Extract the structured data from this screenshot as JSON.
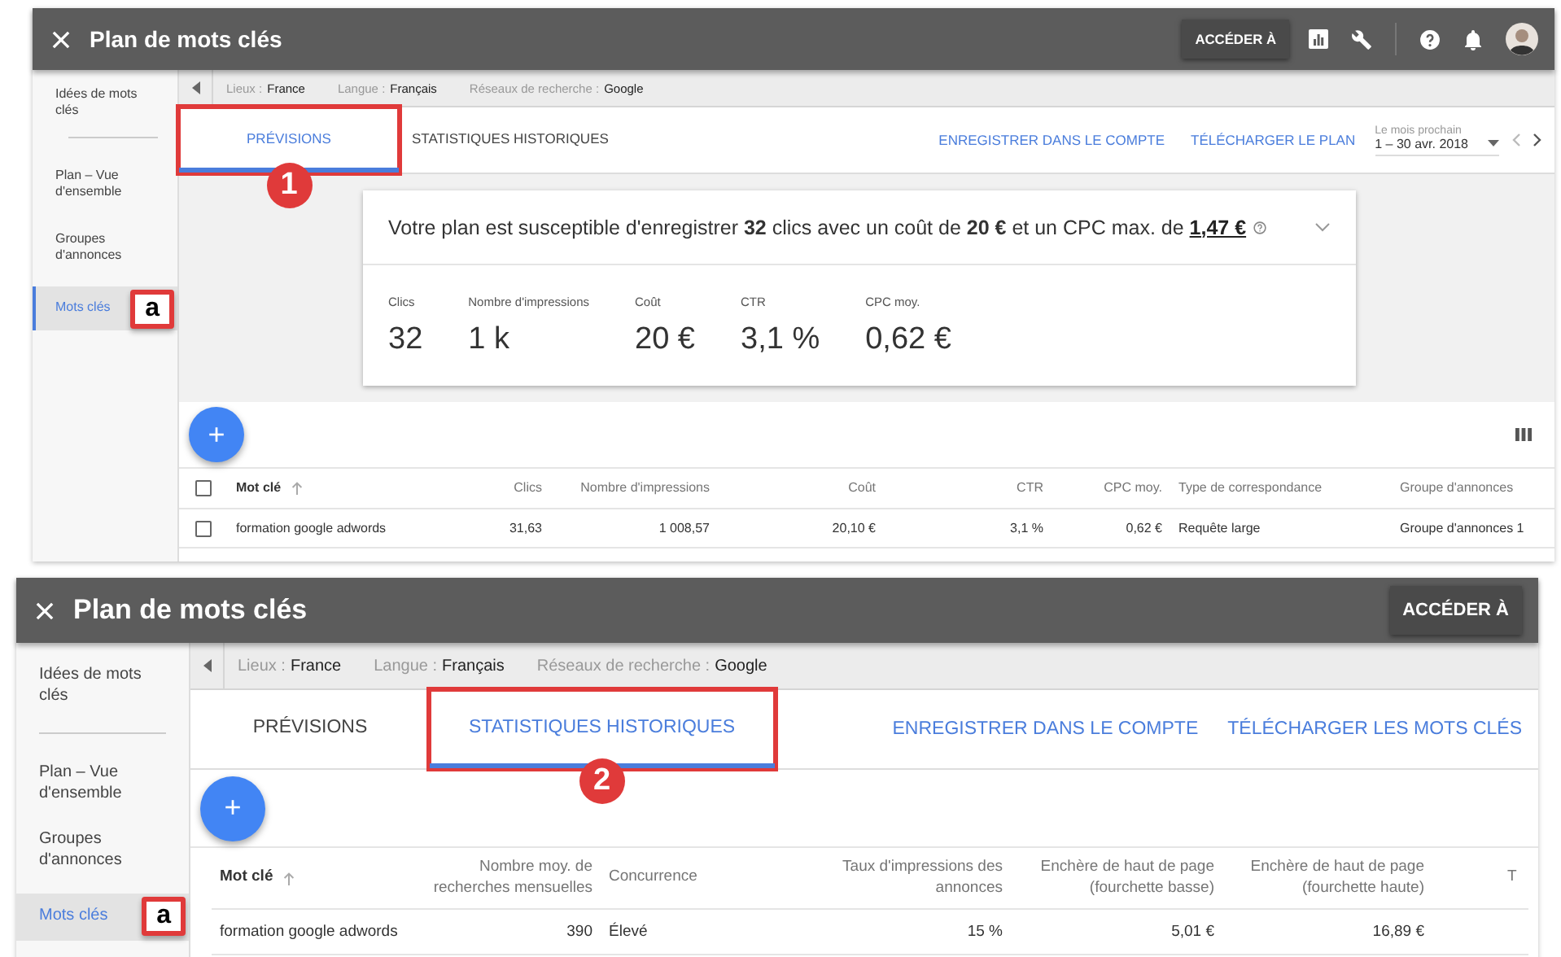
{
  "panels": [
    {
      "title": "Plan de mots clés",
      "goto_button": "ACCÉDER À",
      "header_tools": [
        {
          "kind": "chart"
        },
        {
          "kind": "wrench"
        },
        {
          "kind": "separator"
        },
        {
          "kind": "help"
        },
        {
          "kind": "bell"
        },
        {
          "kind": "avatar"
        }
      ],
      "sidebar": [
        {
          "label": "Idées de mots clés",
          "selected": false,
          "divider_after": true
        },
        {
          "label": "Plan – Vue d'ensemble",
          "selected": false,
          "divider_after": false
        },
        {
          "label": "Groupes d'annonces",
          "selected": false,
          "divider_after": false
        },
        {
          "label": "Mots clés",
          "selected": true,
          "divider_after": false,
          "badge": "a"
        }
      ],
      "filters": [
        {
          "label": "Lieux :",
          "value": "France"
        },
        {
          "label": "Langue :",
          "value": "Français"
        },
        {
          "label": "Réseaux de recherche :",
          "value": "Google"
        }
      ],
      "tabs": [
        {
          "label": "PRÉVISIONS",
          "selected": true,
          "callout": "1"
        },
        {
          "label": "STATISTIQUES HISTORIQUES",
          "selected": false
        }
      ],
      "actions": [
        "ENREGISTRER DANS LE COMPTE",
        "TÉLÉCHARGER LE PLAN"
      ],
      "date_range": {
        "label": "Le mois prochain",
        "value": "1 – 30 avr. 2018"
      },
      "summary": {
        "sentence": "Votre plan est susceptible d'enregistrer **32** clics avec un coût de **20 €** et un CPC max. de",
        "link": "1,47 €",
        "metrics": [
          {
            "label": "Clics",
            "value": "32"
          },
          {
            "label": "Nombre d'impressions",
            "value": "1 k"
          },
          {
            "label": "Coût",
            "value": "20 €"
          },
          {
            "label": "CTR",
            "value": "3,1 %"
          },
          {
            "label": "CPC moy.",
            "value": "0,62 €"
          }
        ]
      },
      "fab": "+",
      "column_picker": true,
      "table": {
        "header_checked": false,
        "columns": [
          {
            "label": "Mot clé",
            "kind": "text",
            "sorted": true
          },
          {
            "label": "Clics",
            "kind": "number",
            "sorted": false
          },
          {
            "label": "Nombre d'impressions",
            "kind": "number",
            "sorted": false
          },
          {
            "label": "Coût",
            "kind": "number",
            "sorted": false
          },
          {
            "label": "CTR",
            "kind": "number",
            "sorted": false
          },
          {
            "label": "CPC moy.",
            "kind": "number",
            "sorted": false
          },
          {
            "label": "Type de correspondance",
            "kind": "text",
            "sorted": false
          },
          {
            "label": "Groupe d'annonces",
            "kind": "text",
            "sorted": false
          }
        ],
        "rows": [
          {
            "checked": false,
            "cells": [
              "formation google adwords",
              "31,63",
              "1 008,57",
              "20,10 €",
              "3,1 %",
              "0,62 €",
              "Requête large",
              "Groupe d'annonces 1"
            ]
          }
        ]
      }
    },
    {
      "title": "Plan de mots clés",
      "goto_button": "ACCÉDER À",
      "sidebar": [
        {
          "label": "Idées de mots clés",
          "selected": false,
          "divider_after": true
        },
        {
          "label": "Plan – Vue d'ensemble",
          "selected": false,
          "divider_after": false
        },
        {
          "label": "Groupes d'annonces",
          "selected": false,
          "divider_after": false
        },
        {
          "label": "Mots clés",
          "selected": true,
          "divider_after": false,
          "badge": "a"
        }
      ],
      "filters": [
        {
          "label": "Lieux :",
          "value": "France"
        },
        {
          "label": "Langue :",
          "value": "Français"
        },
        {
          "label": "Réseaux de recherche :",
          "value": "Google"
        }
      ],
      "tabs": [
        {
          "label": "PRÉVISIONS",
          "selected": false
        },
        {
          "label": "STATISTIQUES HISTORIQUES",
          "selected": true,
          "callout": "2"
        }
      ],
      "actions": [
        "ENREGISTRER DANS LE COMPTE",
        "TÉLÉCHARGER LES MOTS CLÉS"
      ],
      "fab": "+",
      "table": {
        "columns": [
          {
            "label": "Mot clé",
            "kind": "text",
            "sorted": true
          },
          {
            "label": "Nombre moy. de recherches mensuelles",
            "kind": "number",
            "sorted": false
          },
          {
            "label": "Concurrence",
            "kind": "text",
            "sorted": false
          },
          {
            "label": "Taux d'impressions des annonces",
            "kind": "number",
            "sorted": false
          },
          {
            "label": "Enchère de haut de page (fourchette basse)",
            "kind": "number",
            "sorted": false
          },
          {
            "label": "Enchère de haut de page (fourchette haute)",
            "kind": "number",
            "sorted": false
          },
          {
            "label": "T",
            "kind": "text",
            "sorted": false
          }
        ],
        "rows": [
          {
            "cells": [
              "formation google adwords",
              "390",
              "Élevé",
              "15 %",
              "5,01 €",
              "16,89 €"
            ]
          }
        ]
      }
    }
  ]
}
